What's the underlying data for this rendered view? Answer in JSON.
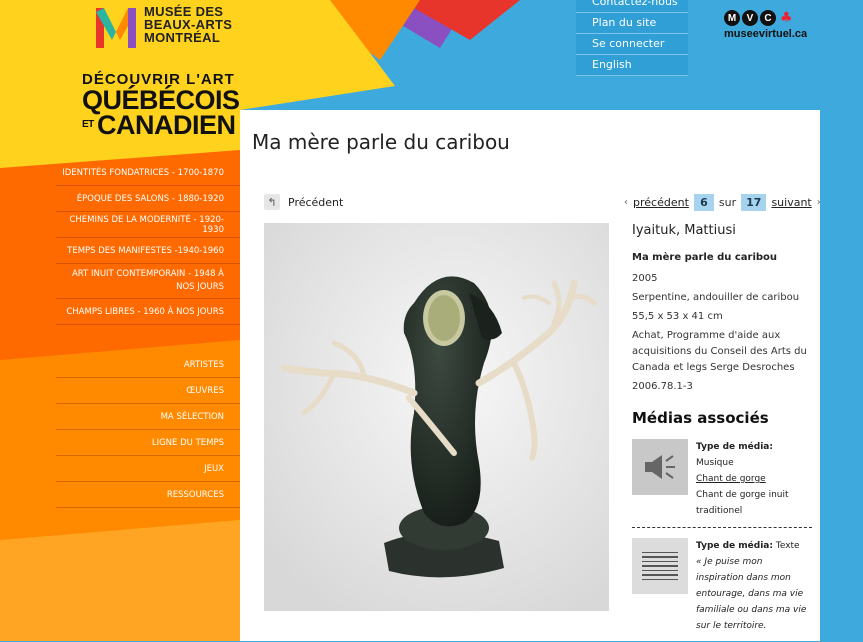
{
  "colors": {
    "sky": "#3ea9dc",
    "yellow": "#ffd21e",
    "orange": "#ff8a00",
    "orange_dark": "#ff6a00",
    "red": "#e8352b",
    "purple": "#8a4fc1",
    "panel": "#ffffff",
    "highlight_box": "#a6d4ef"
  },
  "logo": {
    "lines": [
      "MUSÉE DES",
      "BEAUX-ARTS",
      "MONTRÉAL"
    ]
  },
  "discover": {
    "line1": "DÉCOUVRIR L'ART",
    "line2": "QUÉBÉCOIS",
    "et": "ET",
    "line3": "CANADIEN"
  },
  "menu_periods": [
    "IDENTITÉS FONDATRICES - 1700-1870",
    "ÉPOQUE DES SALONS - 1880-1920",
    "CHEMINS DE LA MODERNITÉ - 1920-1930",
    "TEMPS DES MANIFESTES -1940-1960",
    "ART INUIT CONTEMPORAIN - 1948 À NOS JOURS",
    "CHAMPS LIBRES - 1960 À NOS JOURS"
  ],
  "menu_tools": [
    "ARTISTES",
    "ŒUVRES",
    "MA SÉLECTION",
    "LIGNE DU TEMPS",
    "JEUX",
    "RESSOURCES"
  ],
  "topnav": [
    "Contactez-nous",
    "Plan du site",
    "Se connecter",
    "English"
  ],
  "mvc": {
    "letters": [
      "M",
      "V",
      "C"
    ],
    "url": "museevirtuel.ca"
  },
  "page": {
    "title": "Ma mère parle du caribou",
    "prev_label": "Précédent"
  },
  "pager": {
    "prev": "précédent",
    "current": "6",
    "sep": "sur",
    "total": "17",
    "next": "suivant"
  },
  "artwork": {
    "artist": "Iyaituk, Mattiusi",
    "title": "Ma mère parle du caribou",
    "year": "2005",
    "medium": "Serpentine, andouiller de caribou",
    "dimensions": "55,5 x 53 x 41 cm",
    "credit": "Achat, Programme d'aide aux acquisitions du Conseil des Arts du Canada et legs Serge Desroches",
    "accession": "2006.78.1-3"
  },
  "media": {
    "heading": "Médias associés",
    "items": [
      {
        "icon": "speaker-icon",
        "type_label": "Type de média:",
        "type_value": "Musique",
        "link": "Chant de gorge",
        "desc": "Chant de gorge inuit traditionel"
      },
      {
        "icon": "document-icon",
        "type_label": "Type de média:",
        "type_value": "Texte",
        "quote": "« Je puise mon inspiration dans mon entourage, dans ma vie familiale ou dans ma vie sur le territoire."
      }
    ]
  }
}
